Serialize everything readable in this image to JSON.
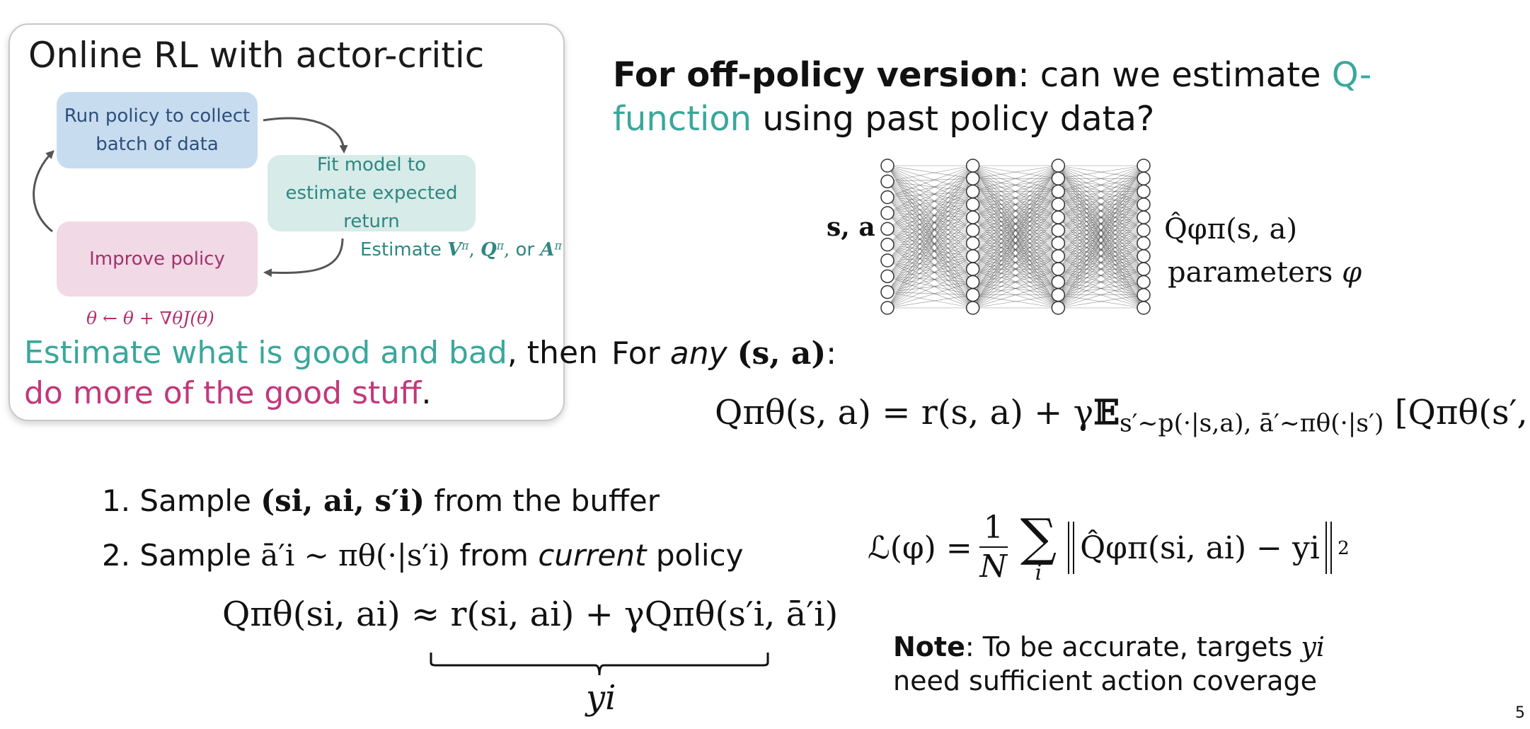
{
  "actor_critic": {
    "title": "Online RL with actor-critic",
    "box_run": "Run policy to collect batch of data",
    "box_fit": "Fit model to estimate expected return",
    "box_improve": "Improve policy",
    "estimate_prefix": "Estimate ",
    "estimate_v": "V",
    "estimate_q": "Q",
    "estimate_a": "A",
    "estimate_or": "or",
    "update_rule": "θ ← θ + ∇θJ(θ)",
    "desc_good_bad": "Estimate what is good and bad",
    "desc_then": ", then",
    "desc_more": "do more of the good stuff",
    "desc_period": "."
  },
  "heading": {
    "bold": "For off-policy version",
    "mid": ": can we estimate ",
    "teal": "Q-function",
    "rest": " using past policy data?"
  },
  "network": {
    "input_label": "s, a",
    "output_label": "Q̂φπ(s, a)",
    "params_text": "parameters",
    "params_symbol": "φ",
    "layers": [
      10,
      12,
      12,
      12
    ]
  },
  "for_any": {
    "prefix": "For ",
    "any": "any",
    "sa": "(s, a)",
    "colon": ":"
  },
  "bellman": {
    "lhs": "Qπθ(s, a) = r(s, a) + γ",
    "expect_sub": "s′∼p(·|s,a), ā′∼πθ(·|s′)",
    "rhs": "[Qπθ(s′, ā′)]"
  },
  "steps": {
    "step1_prefix": "1. Sample ",
    "step1_tuple": "(si, ai, s′i)",
    "step1_suffix": " from the buffer",
    "step2_prefix": "2. Sample ",
    "step2_math": "ā′i ∼ πθ(·|s′i)",
    "step2_mid": " from ",
    "step2_current": "current",
    "step2_suffix": " policy"
  },
  "approx": {
    "lhs": "Qπθ(si, ai) ≈ ",
    "rhs": "r(si, ai) + γQπθ(s′i, ā′i)",
    "brace_label": "yi"
  },
  "loss": {
    "lhs": "ℒ(φ) =",
    "num": "1",
    "den": "N",
    "sum_index": "i",
    "inner": "Q̂φπ(si, ai) − yi",
    "power": "2"
  },
  "note": {
    "bold": "Note",
    "text": ": To be accurate, targets ",
    "y": "yi",
    "text2": " need sufficient action coverage"
  },
  "page_number": "5"
}
